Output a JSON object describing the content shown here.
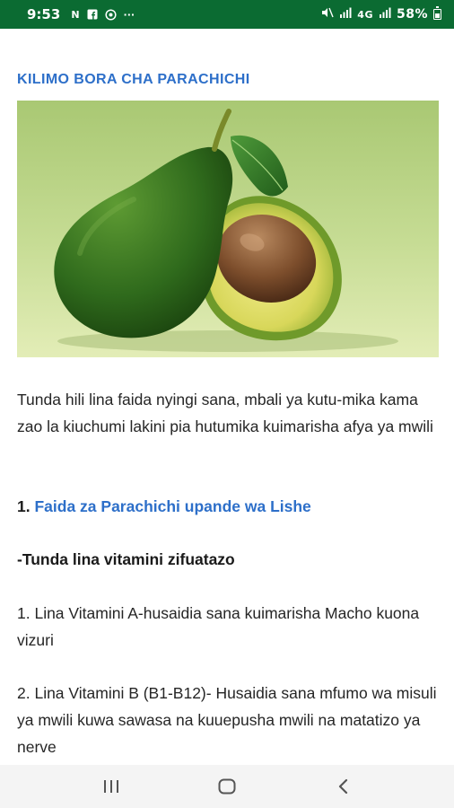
{
  "status_bar": {
    "time": "9:53",
    "notification_icons": [
      "N",
      "F",
      "@",
      "···"
    ],
    "network": "4G",
    "battery": "58%"
  },
  "article": {
    "title": "KILIMO BORA CHA PARACHICHI",
    "hero_image": "avocado-image",
    "intro": "Tunda hili lina faida nyingi sana, mbali ya kutu-mika kama zao la kiuchumi lakini pia hutumika kuimarisha afya ya mwili",
    "section_number": "1.",
    "section_link": "Faida za Parachichi upande wa Lishe",
    "subheading": "-Tunda lina vitamini zifuatazo",
    "item1": "1. Lina Vitamini A-husaidia sana kuimarisha Macho kuona vizuri",
    "item2": "2. Lina Vitamini B (B1-B12)- Husaidia sana mfumo wa misuli ya mwili kuwa sawasa na kuuepusha mwili na matatizo ya nerve"
  },
  "colors": {
    "status_bar": "#0b6b32",
    "link": "#2d6fc9",
    "text": "#262626"
  },
  "nav_bar": {
    "icons": [
      "recent-apps-icon",
      "home-icon",
      "back-icon"
    ]
  }
}
